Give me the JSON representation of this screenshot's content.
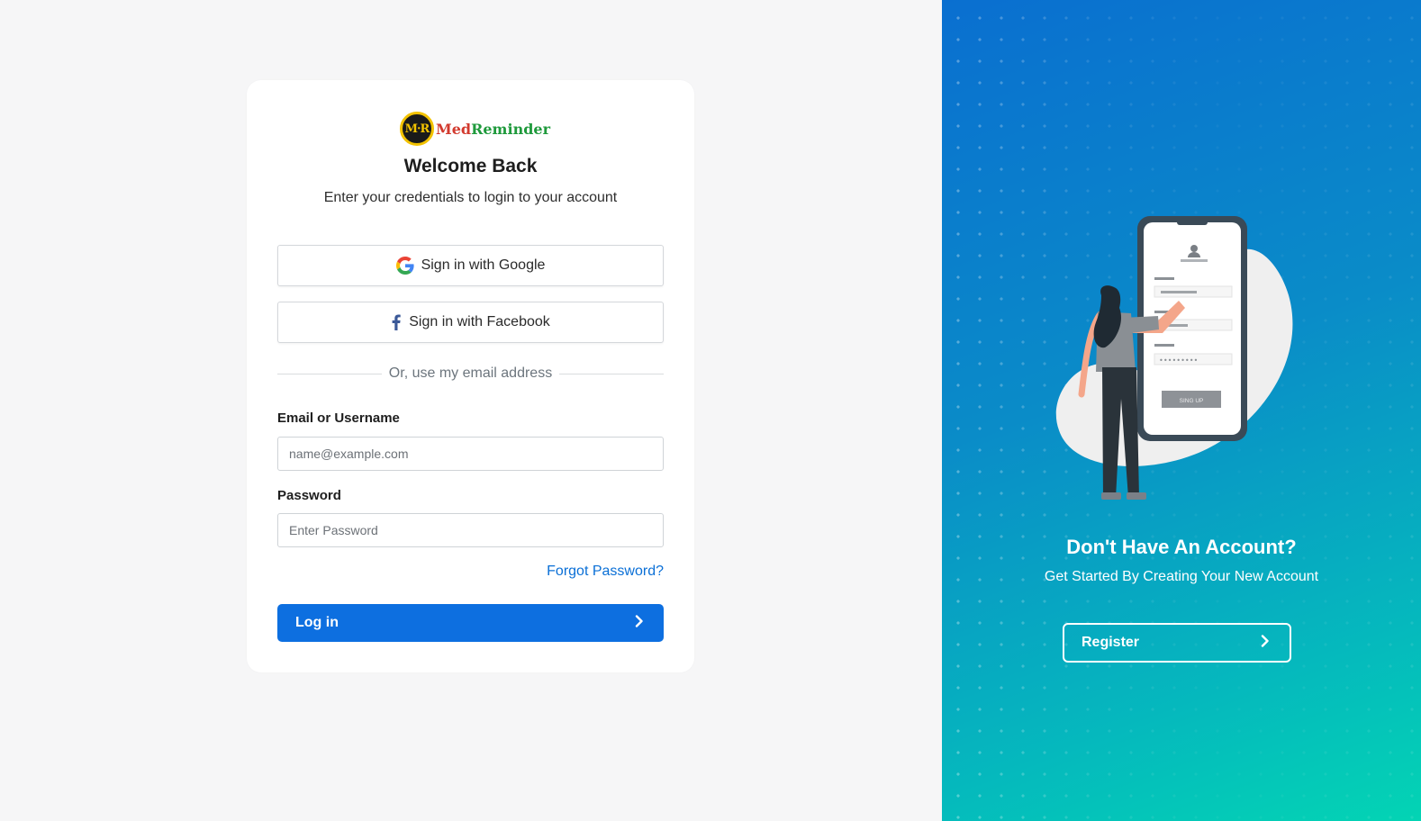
{
  "brand": {
    "logo_initials": "M·R",
    "name_part1": "Med",
    "name_part2": "Reminder"
  },
  "login": {
    "title": "Welcome Back",
    "subtitle": "Enter your credentials to login to your account",
    "google_label": "Sign in with Google",
    "facebook_label": "Sign in with Facebook",
    "divider_text": "Or, use my email address",
    "email_label": "Email or Username",
    "email_placeholder": "name@example.com",
    "email_value": "",
    "password_label": "Password",
    "password_placeholder": "Enter Password",
    "password_value": "",
    "forgot_label": "Forgot Password?",
    "login_label": "Log in"
  },
  "promo": {
    "title": "Don't Have An Account?",
    "subtitle": "Get Started By Creating Your New Account",
    "register_label": "Register",
    "illustration_button_text": "SING UP",
    "illustration_password_mask": "•••••••••"
  },
  "colors": {
    "primary": "#0d6fe0",
    "link": "#0a6fd6",
    "gradient_start": "#0a6fd0",
    "gradient_end": "#03d4b4"
  },
  "icons": {
    "google": "google-g-icon",
    "facebook": "facebook-f-icon",
    "chevron": "chevron-right-icon"
  }
}
